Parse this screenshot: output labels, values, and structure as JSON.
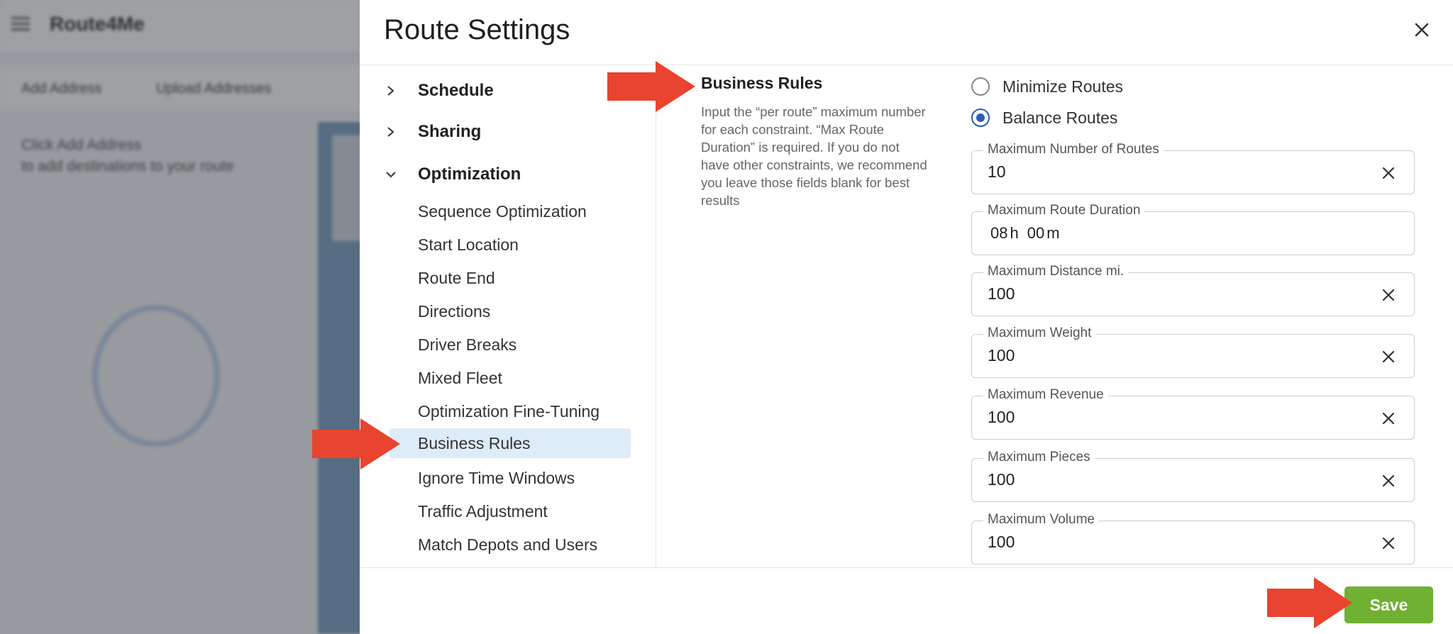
{
  "background": {
    "logo": "Route4Me",
    "toolbar": [
      "Add Address",
      "Upload Addresses"
    ],
    "hint_line1": "Click Add Address",
    "hint_line2": "to add destinations to your route"
  },
  "modal": {
    "title": "Route Settings",
    "save_label": "Save"
  },
  "nav": {
    "groups": [
      {
        "label": "Schedule",
        "expanded": false
      },
      {
        "label": "Sharing",
        "expanded": false
      },
      {
        "label": "Optimization",
        "expanded": true
      }
    ],
    "items": [
      {
        "label": "Sequence Optimization"
      },
      {
        "label": "Start Location"
      },
      {
        "label": "Route End"
      },
      {
        "label": "Directions"
      },
      {
        "label": "Driver Breaks"
      },
      {
        "label": "Mixed Fleet"
      },
      {
        "label": "Optimization Fine-Tuning"
      },
      {
        "label": "Business Rules",
        "active": true
      },
      {
        "label": "Ignore Time Windows"
      },
      {
        "label": "Traffic Adjustment"
      },
      {
        "label": "Match Depots and Users"
      }
    ]
  },
  "section": {
    "title": "Business Rules",
    "description": "Input the “per route” maximum number for each constraint. “Max Route Duration” is required. If you do not have other constraints, we recommend you leave those fields blank for best results"
  },
  "options": {
    "minimize": {
      "label": "Minimize Routes",
      "checked": false
    },
    "balance": {
      "label": "Balance Routes",
      "checked": true
    }
  },
  "fields": {
    "max_routes": {
      "label": "Maximum Number of Routes",
      "value": "10"
    },
    "max_duration": {
      "label": "Maximum Route Duration",
      "hours": "08",
      "hours_unit": "h",
      "minutes": "00",
      "minutes_unit": "m"
    },
    "max_distance": {
      "label": "Maximum Distance mi.",
      "value": "100"
    },
    "max_weight": {
      "label": "Maximum Weight",
      "value": "100"
    },
    "max_revenue": {
      "label": "Maximum Revenue",
      "value": "100"
    },
    "max_pieces": {
      "label": "Maximum Pieces",
      "value": "100"
    },
    "max_volume": {
      "label": "Maximum Volume",
      "value": "100"
    }
  },
  "colors": {
    "accent": "#2f5bb7",
    "active_nav": "#deebf9",
    "save_button": "#70b033",
    "arrow": "#e8442f"
  },
  "icons": {
    "close": "close-icon",
    "collapsed": "chevron-right-icon",
    "expanded": "chevron-down-icon",
    "clear": "clear-icon"
  }
}
